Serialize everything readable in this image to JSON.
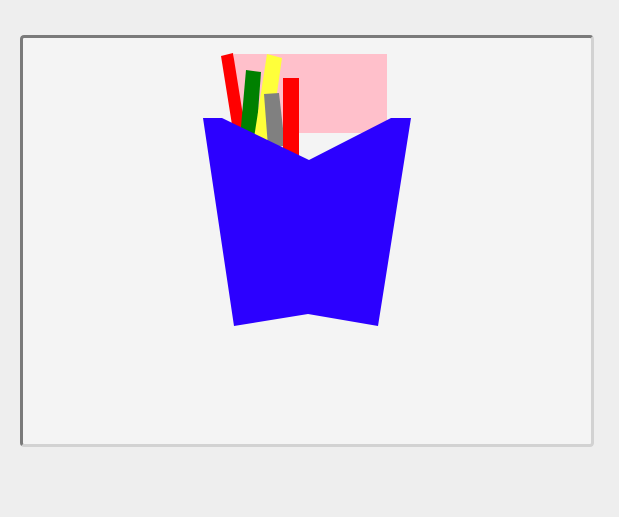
{
  "colors": {
    "page_background": "#eeeeee",
    "panel_background": "#f4f4f4",
    "panel_border_dark": "#7a7a7a",
    "panel_border_light": "#d2d2d2",
    "note_fill": "#ffc0cb",
    "cup_fill": "#2c00ff",
    "stick_red": "#ff0000",
    "stick_green": "#008000",
    "stick_yellow": "#ffff3a",
    "stick_gray": "#808080"
  },
  "scene": {
    "items": [
      {
        "name": "pink-note-card",
        "kind": "rect"
      },
      {
        "name": "red-pencil-left",
        "kind": "stick"
      },
      {
        "name": "green-pencil",
        "kind": "stick"
      },
      {
        "name": "yellow-pencil",
        "kind": "stick"
      },
      {
        "name": "gray-pencil",
        "kind": "stick"
      },
      {
        "name": "red-pencil-right",
        "kind": "stick"
      },
      {
        "name": "blue-pen-cup",
        "kind": "cup"
      }
    ]
  }
}
